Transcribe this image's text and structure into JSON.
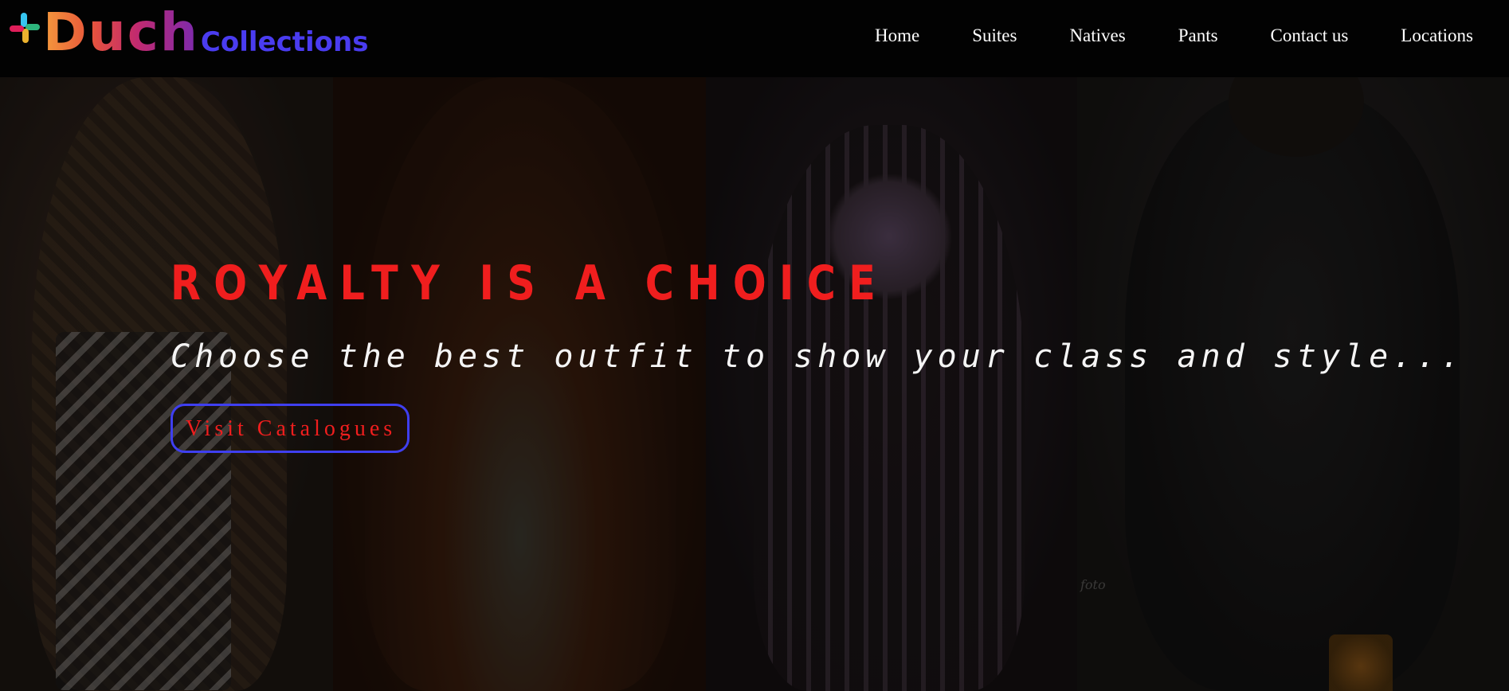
{
  "brand": {
    "name": "Duch",
    "sub": "Collections"
  },
  "nav": {
    "items": [
      {
        "label": "Home"
      },
      {
        "label": "Suites"
      },
      {
        "label": "Natives"
      },
      {
        "label": "Pants"
      },
      {
        "label": "Contact us"
      },
      {
        "label": "Locations"
      }
    ]
  },
  "hero": {
    "headline": "ROYALTY IS A CHOICE",
    "subline": "Choose the best outfit to show your class and style...",
    "cta_label": "Visit Catalogues",
    "watermark": "foto"
  },
  "colors": {
    "headline": "#f01e1e",
    "cta_border": "#3f3ff0",
    "brand_sub": "#4a3cf0",
    "nav_bg": "#020202"
  }
}
